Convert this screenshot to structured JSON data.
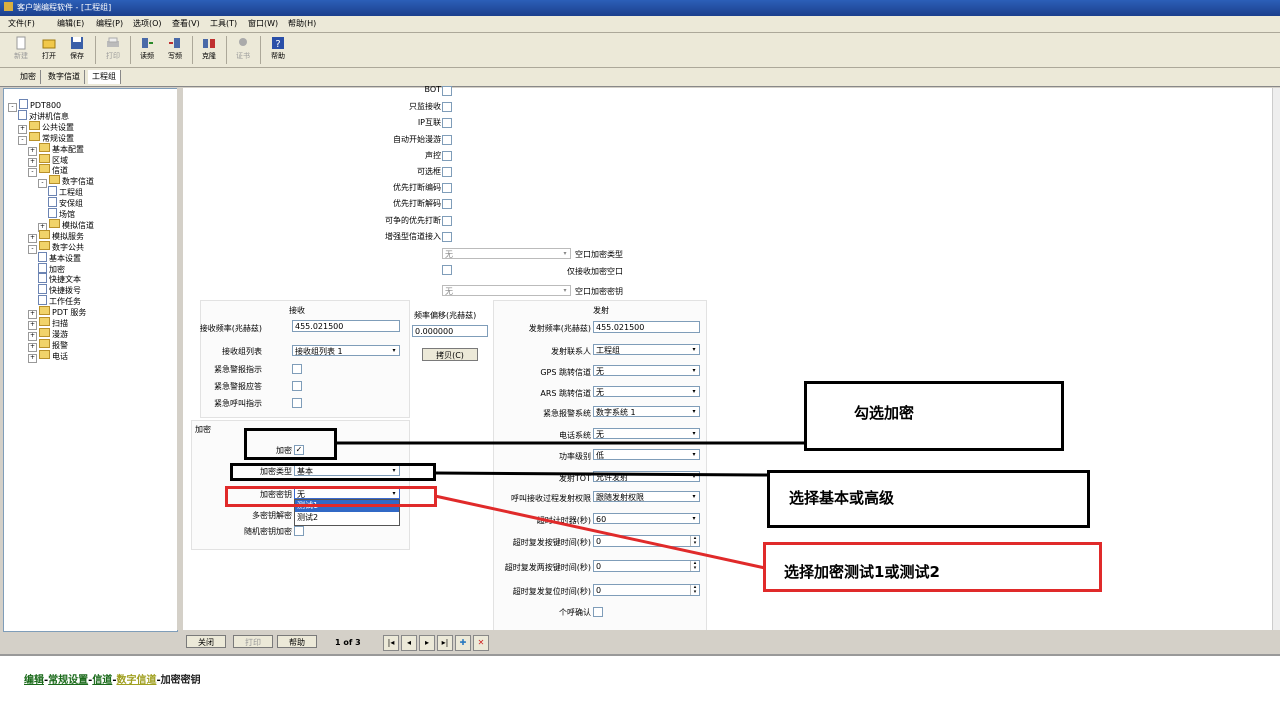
{
  "window": {
    "title": "客户端编程软件 - [工程组]"
  },
  "menu": [
    "文件(F)",
    "编辑(E)",
    "编程(P)",
    "选项(O)",
    "查看(V)",
    "工具(T)",
    "窗口(W)",
    "帮助(H)"
  ],
  "toolbar": [
    {
      "label": "新建",
      "icon": "new-file-icon",
      "disabled": true
    },
    {
      "label": "打开",
      "icon": "open-folder-icon",
      "disabled": false
    },
    {
      "label": "保存",
      "icon": "save-icon",
      "disabled": false
    },
    {
      "label": "打印",
      "icon": "print-icon",
      "disabled": true
    },
    {
      "label": "读频",
      "icon": "read-radio-icon",
      "disabled": false
    },
    {
      "label": "写频",
      "icon": "write-radio-icon",
      "disabled": false
    },
    {
      "label": "克隆",
      "icon": "clone-icon",
      "disabled": false
    },
    {
      "label": "证书",
      "icon": "certificate-icon",
      "disabled": true
    },
    {
      "label": "帮助",
      "icon": "help-icon",
      "disabled": false
    }
  ],
  "tabs": [
    "加密",
    "数字信道",
    "工程组"
  ],
  "tree": [
    {
      "label": "PDT800",
      "level": 0,
      "expander": "-",
      "kind": "device"
    },
    {
      "label": "对讲机信息",
      "level": 1,
      "expander": "",
      "kind": "doc"
    },
    {
      "label": "公共设置",
      "level": 1,
      "expander": "+",
      "kind": "folder"
    },
    {
      "label": "常规设置",
      "level": 1,
      "expander": "-",
      "kind": "folder"
    },
    {
      "label": "基本配置",
      "level": 2,
      "expander": "+",
      "kind": "folder"
    },
    {
      "label": "区域",
      "level": 2,
      "expander": "+",
      "kind": "folder"
    },
    {
      "label": "信道",
      "level": 2,
      "expander": "-",
      "kind": "folder"
    },
    {
      "label": "数字信道",
      "level": 3,
      "expander": "-",
      "kind": "folder"
    },
    {
      "label": "工程组",
      "level": 4,
      "expander": "",
      "kind": "doc"
    },
    {
      "label": "安保组",
      "level": 4,
      "expander": "",
      "kind": "doc"
    },
    {
      "label": "场馆",
      "level": 4,
      "expander": "",
      "kind": "doc"
    },
    {
      "label": "模拟信道",
      "level": 3,
      "expander": "+",
      "kind": "folder"
    },
    {
      "label": "模拟服务",
      "level": 2,
      "expander": "+",
      "kind": "folder"
    },
    {
      "label": "数字公共",
      "level": 2,
      "expander": "-",
      "kind": "folder"
    },
    {
      "label": "基本设置",
      "level": 3,
      "expander": "",
      "kind": "doc"
    },
    {
      "label": "加密",
      "level": 3,
      "expander": "",
      "kind": "doc"
    },
    {
      "label": "快捷文本",
      "level": 3,
      "expander": "",
      "kind": "doc"
    },
    {
      "label": "快捷拨号",
      "level": 3,
      "expander": "",
      "kind": "doc"
    },
    {
      "label": "工作任务",
      "level": 3,
      "expander": "",
      "kind": "doc"
    },
    {
      "label": "PDT 服务",
      "level": 2,
      "expander": "+",
      "kind": "folder"
    },
    {
      "label": "扫描",
      "level": 2,
      "expander": "+",
      "kind": "folder"
    },
    {
      "label": "漫游",
      "level": 2,
      "expander": "+",
      "kind": "folder"
    },
    {
      "label": "报警",
      "level": 2,
      "expander": "+",
      "kind": "folder"
    },
    {
      "label": "电话",
      "level": 2,
      "expander": "+",
      "kind": "folder"
    }
  ],
  "upper_checkboxes": [
    "BOT",
    "只监接收",
    "IP互联",
    "自动开始漫游",
    "声控",
    "可选框",
    "优先打断编码",
    "优先打断解码",
    "可争的优先打断",
    "增强型信道接入"
  ],
  "air_enc": {
    "type_label": "空口加密类型",
    "type_value": "无",
    "rx_only_label": "仅接收加密空口",
    "key_label": "空口加密密钥",
    "key_value": "无"
  },
  "receive": {
    "header": "接收",
    "freq_label": "接收频率(兆赫兹)",
    "freq_value": "455.021500",
    "grouplist_label": "接收组列表",
    "grouplist_value": "接收组列表 1",
    "checks": [
      "紧急警报指示",
      "紧急警报应答",
      "紧急呼叫指示"
    ]
  },
  "offset": {
    "header": "频率偏移(兆赫兹)",
    "value": "0.000000",
    "copy_button": "拷贝(C)"
  },
  "encryption": {
    "header": "加密",
    "enable_label": "加密",
    "enable_checked": "✓",
    "type_label": "加密类型",
    "type_value": "基本",
    "key_label": "加密密钥",
    "key_value": "无",
    "options": [
      "测试1",
      "测试2"
    ],
    "multikey_label": "多密钥解密",
    "random_label": "随机密钥加密"
  },
  "transmit": {
    "header": "发射",
    "freq_label": "发射频率(兆赫兹)",
    "freq_value": "455.021500",
    "contact_label": "发射联系人",
    "contact_value": "工程组",
    "gps_label": "GPS 跳转信道",
    "gps_value": "无",
    "ars_label": "ARS 跳转信道",
    "ars_value": "无",
    "emergency_label": "紧急报警系统",
    "emergency_value": "数字系统 1",
    "phone_label": "电话系统",
    "phone_value": "无",
    "power_label": "功率级别",
    "power_value": "低",
    "tot_label": "发射TOT",
    "tot_value": "允许发射",
    "permit_label": "呼叫接收过程发射权限",
    "permit_value": "跟随发射权限",
    "timer_label": "超时计时器(秒)",
    "timer_value": "60",
    "rekey_label": "超时复发按键时间(秒)",
    "rekey_value": "0",
    "twokey_label": "超时复发两按键时间(秒)",
    "twokey_value": "0",
    "reset_label": "超时复发复位时间(秒)",
    "reset_value": "0",
    "ack_label": "个呼确认"
  },
  "nav": {
    "close": "关闭",
    "print": "打印",
    "help": "帮助",
    "page": "1 of 3"
  },
  "breadcrumb": [
    "编辑",
    "常规设置",
    "信道",
    "数字信道",
    "加密密钥"
  ],
  "annotations": {
    "check_enc": "勾选加密",
    "select_type": "选择基本或高级",
    "select_key": "选择加密测试1或测试2"
  },
  "colors": {
    "annotation_black": "#000000",
    "annotation_red": "#e02a2a",
    "titlebar": "#2c5fb8"
  }
}
